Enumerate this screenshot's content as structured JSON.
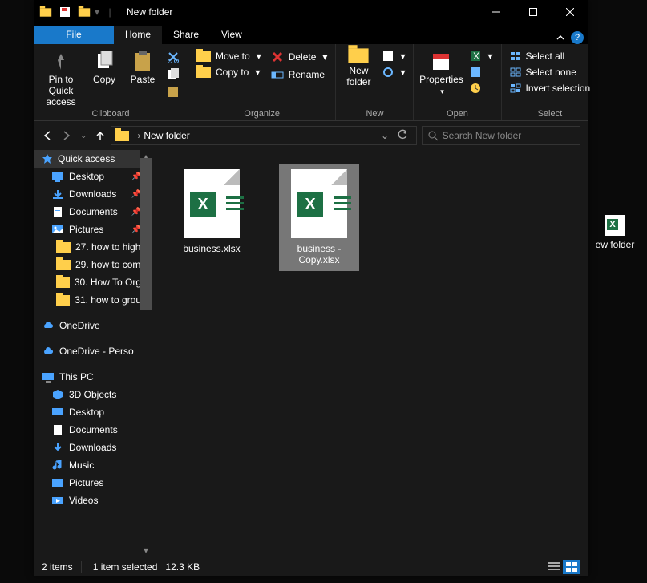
{
  "window": {
    "title": "New folder"
  },
  "menu": {
    "file": "File",
    "home": "Home",
    "share": "Share",
    "view": "View"
  },
  "ribbon": {
    "clipboard": {
      "label": "Clipboard",
      "pin": "Pin to Quick access",
      "copy": "Copy",
      "paste": "Paste"
    },
    "organize": {
      "label": "Organize",
      "move": "Move to",
      "copyto": "Copy to",
      "delete": "Delete",
      "rename": "Rename"
    },
    "new": {
      "label": "New",
      "newfolder": "New folder"
    },
    "open": {
      "label": "Open",
      "properties": "Properties"
    },
    "select": {
      "label": "Select",
      "all": "Select all",
      "none": "Select none",
      "invert": "Invert selection"
    }
  },
  "address": {
    "crumb": "New folder"
  },
  "search": {
    "placeholder": "Search New folder"
  },
  "sidebar": {
    "quick": "Quick access",
    "desktop": "Desktop",
    "downloads": "Downloads",
    "documents": "Documents",
    "pictures": "Pictures",
    "f1": "27. how to high",
    "f2": "29. how to com",
    "f3": "30. How To Org",
    "f4": "31. how to grou",
    "onedrive": "OneDrive",
    "onedrivep": "OneDrive - Perso",
    "thispc": "This PC",
    "obj3d": "3D Objects",
    "desktop2": "Desktop",
    "documents2": "Documents",
    "downloads2": "Downloads",
    "music": "Music",
    "pictures2": "Pictures",
    "videos": "Videos"
  },
  "files": {
    "a": "business.xlsx",
    "b": "business - Copy.xlsx"
  },
  "status": {
    "items": "2 items",
    "selected": "1 item selected",
    "size": "12.3 KB"
  },
  "desktop": {
    "label": "ew folder"
  }
}
